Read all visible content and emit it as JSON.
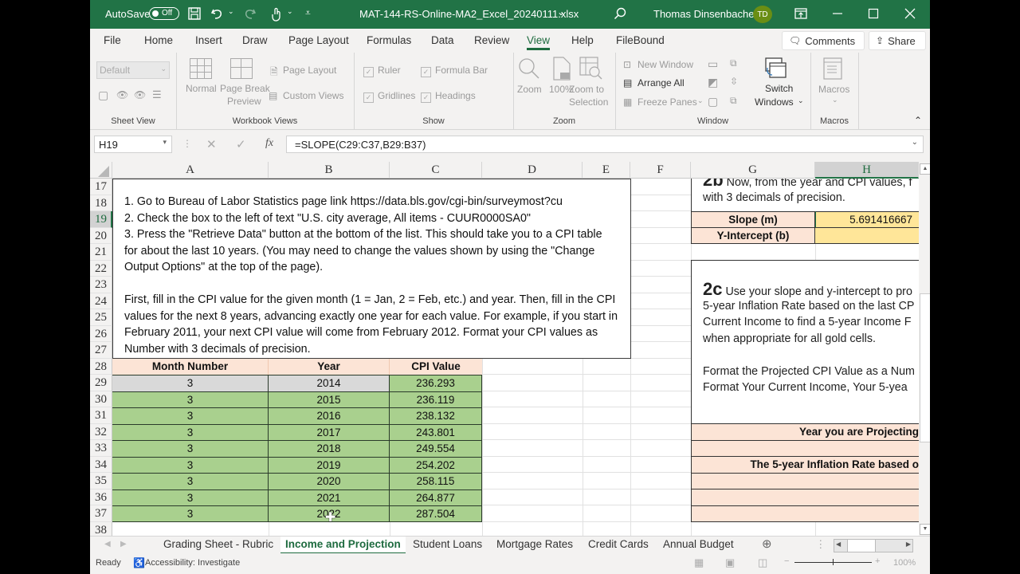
{
  "titlebar": {
    "autosave_label": "AutoSave",
    "autosave_state": "Off",
    "filename": "MAT-144-RS-Online-MA2_Excel_20240111.xlsx",
    "user_name": "Thomas Dinsenbacher",
    "user_initials": "TD",
    "accent_color": "#217346"
  },
  "menu": {
    "tabs": [
      "File",
      "Home",
      "Insert",
      "Draw",
      "Page Layout",
      "Formulas",
      "Data",
      "Review",
      "View",
      "Help",
      "FileBound"
    ],
    "active_tab": "View",
    "comments_label": "Comments",
    "share_label": "Share"
  },
  "ribbon": {
    "sheet_view": {
      "dropdown_value": "Default",
      "group_label": "Sheet View"
    },
    "workbook_views": {
      "normal": "Normal",
      "page_break_1": "Page Break",
      "page_break_2": "Preview",
      "page_layout": "Page Layout",
      "custom_views": "Custom Views",
      "group_label": "Workbook Views"
    },
    "show": {
      "ruler": "Ruler",
      "formula_bar": "Formula Bar",
      "gridlines": "Gridlines",
      "headings": "Headings",
      "group_label": "Show"
    },
    "zoom": {
      "zoom": "Zoom",
      "hundred": "100%",
      "zoom_sel_1": "Zoom to",
      "zoom_sel_2": "Selection",
      "group_label": "Zoom"
    },
    "window": {
      "new_window": "New Window",
      "arrange_all": "Arrange All",
      "freeze_panes": "Freeze Panes",
      "switch_1": "Switch",
      "switch_2": "Windows",
      "group_label": "Window"
    },
    "macros": {
      "macros": "Macros",
      "group_label": "Macros"
    }
  },
  "formula_bar": {
    "name_box": "H19",
    "formula": "=SLOPE(C29:C37,B29:B37)"
  },
  "columns": [
    "A",
    "B",
    "C",
    "D",
    "E",
    "F",
    "G",
    "H"
  ],
  "selected_column": "H",
  "rows": [
    "17",
    "18",
    "19",
    "20",
    "21",
    "22",
    "23",
    "24",
    "25",
    "26",
    "27",
    "28",
    "29",
    "30",
    "31",
    "32",
    "33",
    "34",
    "35",
    "36",
    "37",
    "38"
  ],
  "selected_row": "19",
  "instructions": {
    "lines": [
      "1. Go to Bureau of Labor Statistics page link https://data.bls.gov/cgi-bin/surveymost?cu",
      "2. Check the box to the left of text \"U.S. city average, All items - CUUR0000SA0\"",
      "3. Press the \"Retrieve Data\" button at the bottom of the list.  This should take you to a CPI table",
      "for about the last 10 years. (You may need to change the values shown by using the \"Change",
      "Output Options\" at the top of the page).",
      "",
      "First, fill in the CPI value for the given month (1 = Jan, 2 = Feb, etc.) and year.  Then, fill in the CPI",
      "values for the next 8 years, advancing exactly one year for each value.  For example, if you start in",
      "February 2011, your next CPI value will come from February 2012.  Format your CPI values as",
      "Number with 3 decimals of precision."
    ]
  },
  "cpi_table": {
    "headers": [
      "Month Number",
      "Year",
      "CPI Value"
    ],
    "rows": [
      [
        "3",
        "2014",
        "236.293"
      ],
      [
        "3",
        "2015",
        "236.119"
      ],
      [
        "3",
        "2016",
        "238.132"
      ],
      [
        "3",
        "2017",
        "243.801"
      ],
      [
        "3",
        "2018",
        "249.554"
      ],
      [
        "3",
        "2019",
        "254.202"
      ],
      [
        "3",
        "2020",
        "258.115"
      ],
      [
        "3",
        "2021",
        "264.877"
      ],
      [
        "3",
        "2022",
        "287.504"
      ]
    ]
  },
  "section_2b": {
    "heading": "2b",
    "line1": " Now, from the year and CPI values, f",
    "line2": "with 3 decimals of precision.",
    "slope_label": "Slope (m)",
    "slope_value": "5.691416667",
    "intercept_label": "Y-Intercept (b)",
    "intercept_value": ""
  },
  "section_2c": {
    "heading": "2c",
    "lines": [
      " Use your slope and y-intercept to pro",
      "5-year Inflation Rate based on the last CP",
      "Current Income to find a 5-year Income F",
      "when appropriate for all gold cells.",
      "",
      "Format the Projected CPI Value as a Num",
      "Format Your Current Income, Your 5-yea"
    ],
    "year_projecting_label": "Year you are Projecting",
    "inflation_label": "The 5-year Inflation Rate based o"
  },
  "sheet_tabs": [
    "Grading Sheet - Rubric",
    "Income and Projection",
    "Student Loans",
    "Mortgage Rates",
    "Credit Cards",
    "Annual Budget"
  ],
  "active_sheet": "Income and Projection",
  "status": {
    "ready": "Ready",
    "accessibility": "Accessibility: Investigate",
    "zoom": "100%"
  }
}
